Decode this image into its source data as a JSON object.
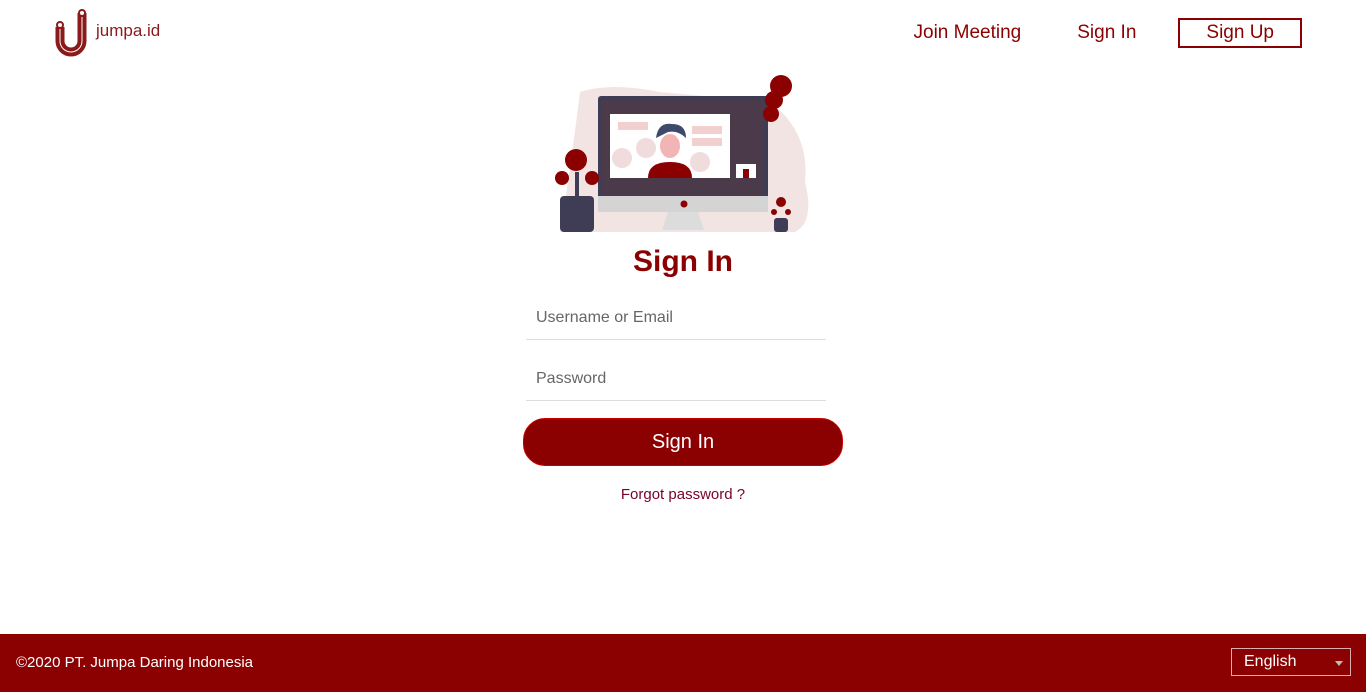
{
  "header": {
    "brand": "jumpa.id",
    "nav": {
      "join_meeting": "Join Meeting",
      "sign_in": "Sign In",
      "sign_up": "Sign Up"
    }
  },
  "form": {
    "title": "Sign In",
    "username_placeholder": "Username or Email",
    "password_placeholder": "Password",
    "submit": "Sign In",
    "forgot": "Forgot password ?"
  },
  "footer": {
    "copyright": "©2020 PT. Jumpa Daring Indonesia",
    "language": "English"
  },
  "colors": {
    "brand": "#8b0000"
  }
}
